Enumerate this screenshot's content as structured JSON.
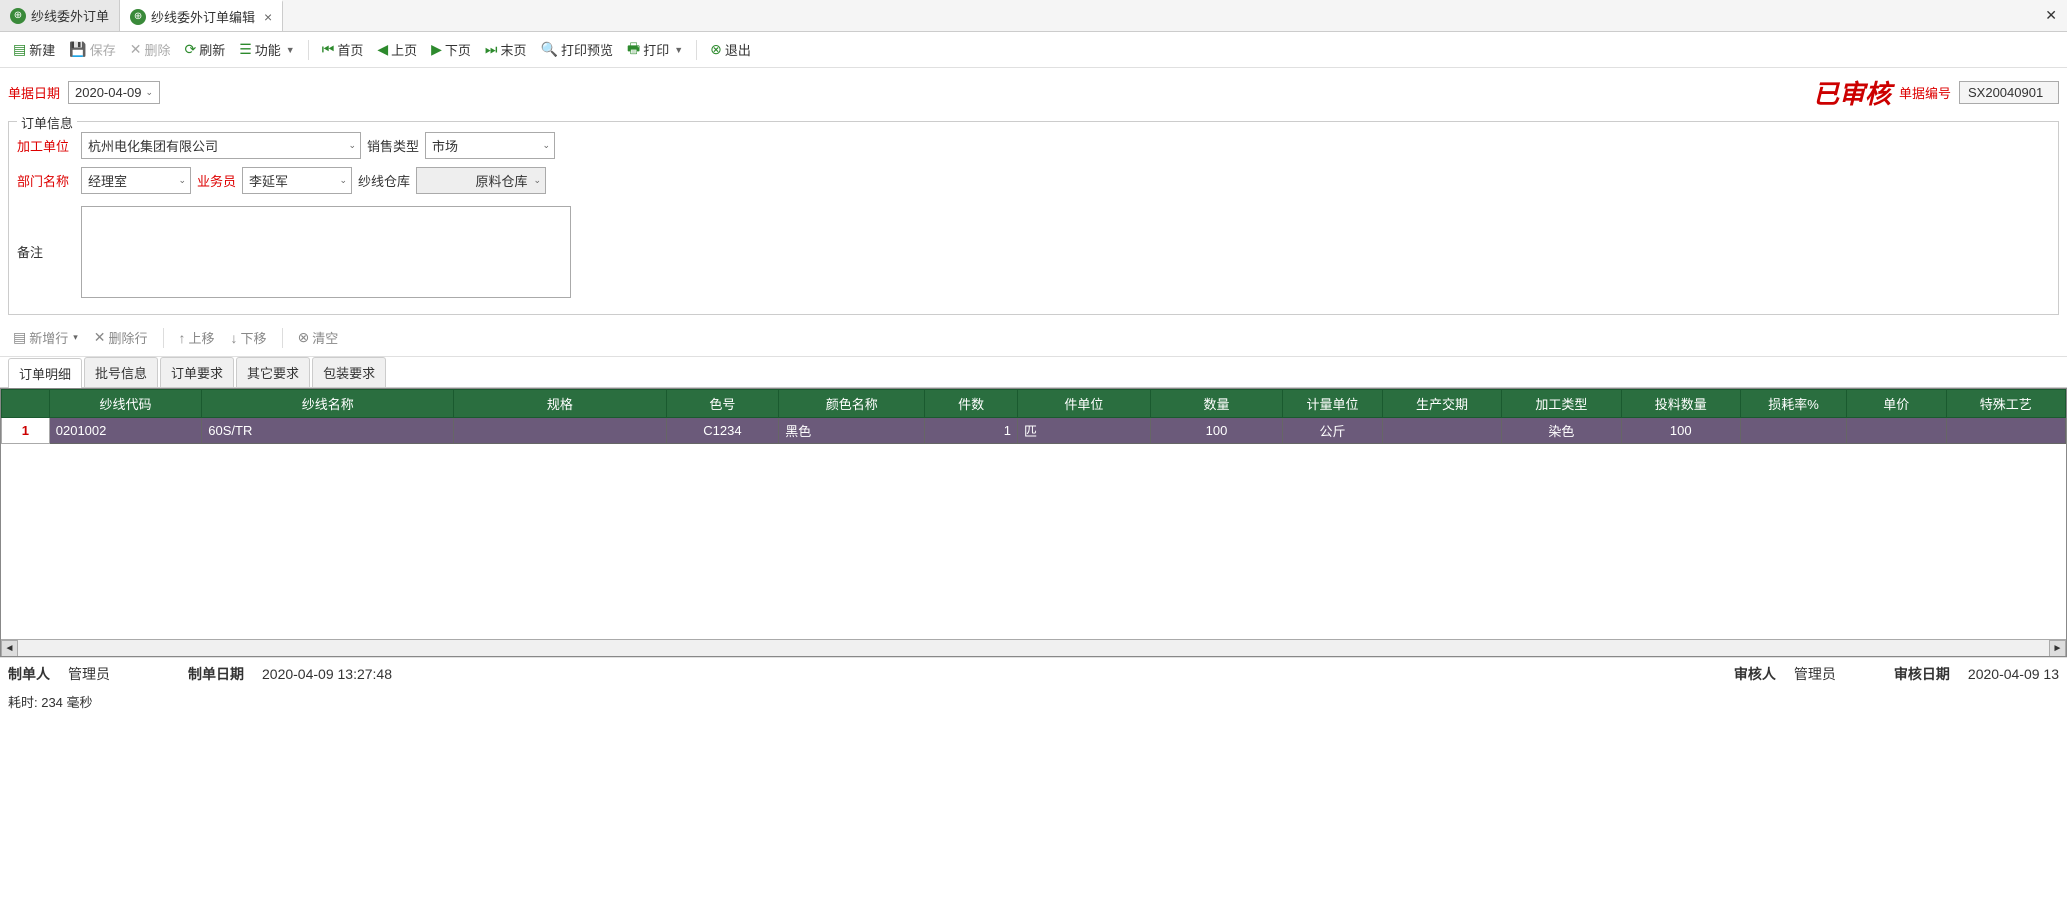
{
  "tabs": [
    {
      "label": "纱线委外订单"
    },
    {
      "label": "纱线委外订单编辑"
    }
  ],
  "toolbar": {
    "new": "新建",
    "save": "保存",
    "delete": "删除",
    "refresh": "刷新",
    "functions": "功能",
    "first": "首页",
    "prev": "上页",
    "next": "下页",
    "last": "末页",
    "preview": "打印预览",
    "print": "打印",
    "exit": "退出"
  },
  "header": {
    "date_label": "单据日期",
    "date_value": "2020-04-09",
    "status_stamp": "已审核",
    "doc_no_label": "单据编号",
    "doc_no": "SX20040901"
  },
  "order_info": {
    "legend": "订单信息",
    "process_unit_label": "加工单位",
    "process_unit": "杭州电化集团有限公司",
    "sale_type_label": "销售类型",
    "sale_type": "市场",
    "dept_label": "部门名称",
    "dept": "经理室",
    "salesman_label": "业务员",
    "salesman": "李延军",
    "yarn_wh_label": "纱线仓库",
    "yarn_wh": "原料仓库",
    "remark_label": "备注",
    "remark": ""
  },
  "row_toolbar": {
    "add": "新增行",
    "del": "删除行",
    "up": "上移",
    "down": "下移",
    "clear": "清空"
  },
  "subtabs": [
    "订单明细",
    "批号信息",
    "订单要求",
    "其它要求",
    "包装要求"
  ],
  "grid": {
    "columns": [
      "纱线代码",
      "纱线名称",
      "规格",
      "色号",
      "颜色名称",
      "件数",
      "件单位",
      "数量",
      "计量单位",
      "生产交期",
      "加工类型",
      "投料数量",
      "损耗率%",
      "单价",
      "特殊工艺"
    ],
    "rows": [
      {
        "num": "1",
        "cells": [
          "0201002",
          "60S/TR",
          "",
          "C1234",
          "黑色",
          "1",
          "匹",
          "100",
          "公斤",
          "",
          "染色",
          "100",
          "",
          "",
          ""
        ]
      }
    ]
  },
  "footer": {
    "maker_label": "制单人",
    "maker": "管理员",
    "make_date_label": "制单日期",
    "make_date": "2020-04-09 13:27:48",
    "auditor_label": "审核人",
    "auditor": "管理员",
    "audit_date_label": "审核日期",
    "audit_date": "2020-04-09 13"
  },
  "status": "耗时: 234 毫秒"
}
